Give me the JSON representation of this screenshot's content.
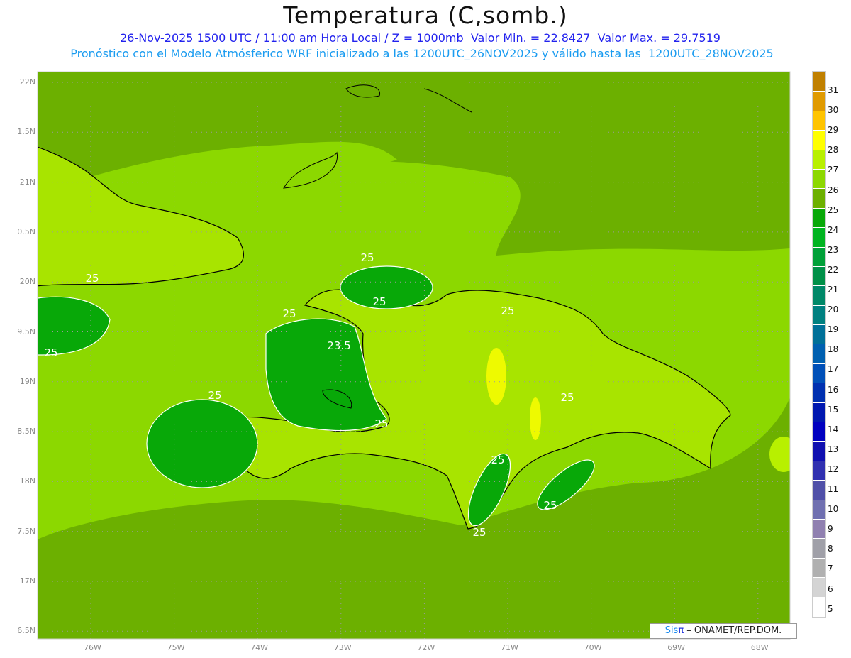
{
  "header": {
    "title": "Temperatura (C,somb.)",
    "subtitle1": "26-Nov-2025 1500 UTC / 11:00 am Hora Local / Z = 1000mb  Valor Min. = 22.8427  Valor Max. = 29.7519",
    "subtitle2": "Pronóstico con el Modelo Atmósferico WRF inicializado a las 1200UTC_26NOV2025 y válido hasta las  1200UTC_28NOV2025"
  },
  "axes": {
    "lon_labels": [
      "76W",
      "75W",
      "74W",
      "73W",
      "72W",
      "71W",
      "70W",
      "69W",
      "68W"
    ],
    "lat_labels": [
      "22N",
      "1.5N",
      "21N",
      "0.5N",
      "20N",
      "9.5N",
      "19N",
      "8.5N",
      "18N",
      "7.5N",
      "17N",
      "6.5N"
    ]
  },
  "contour_labels": [
    {
      "text": "25"
    },
    {
      "text": "25"
    },
    {
      "text": "25"
    },
    {
      "text": "25"
    },
    {
      "text": "25"
    },
    {
      "text": "23.5"
    },
    {
      "text": "25"
    },
    {
      "text": "25"
    },
    {
      "text": "25"
    },
    {
      "text": "25"
    },
    {
      "text": "25"
    },
    {
      "text": "25"
    },
    {
      "text": "25"
    }
  ],
  "colorbar": {
    "labels": [
      "31",
      "30",
      "29",
      "28",
      "27",
      "26",
      "25",
      "24",
      "23",
      "22",
      "21",
      "20",
      "19",
      "18",
      "17",
      "16",
      "15",
      "14",
      "13",
      "12",
      "11",
      "10",
      "9",
      "8",
      "7",
      "6",
      "5"
    ],
    "colors": [
      "#c08000",
      "#e09a00",
      "#ffc400",
      "#ffff00",
      "#b8f000",
      "#8cd800",
      "#6cb000",
      "#08a808",
      "#00b420",
      "#00a038",
      "#009048",
      "#008868",
      "#008080",
      "#007098",
      "#0060b0",
      "#0050b8",
      "#0030b0",
      "#0018b0",
      "#0000c0",
      "#1010b0",
      "#3030b0",
      "#5050a8",
      "#7070b0",
      "#9080b0",
      "#a0a0a8",
      "#b0b0b0",
      "#d4d4d4",
      "#ffffff"
    ]
  },
  "credit": {
    "sis": "Sis",
    "pi": "π",
    "rest": " – ONAMET/REP.DOM."
  }
}
